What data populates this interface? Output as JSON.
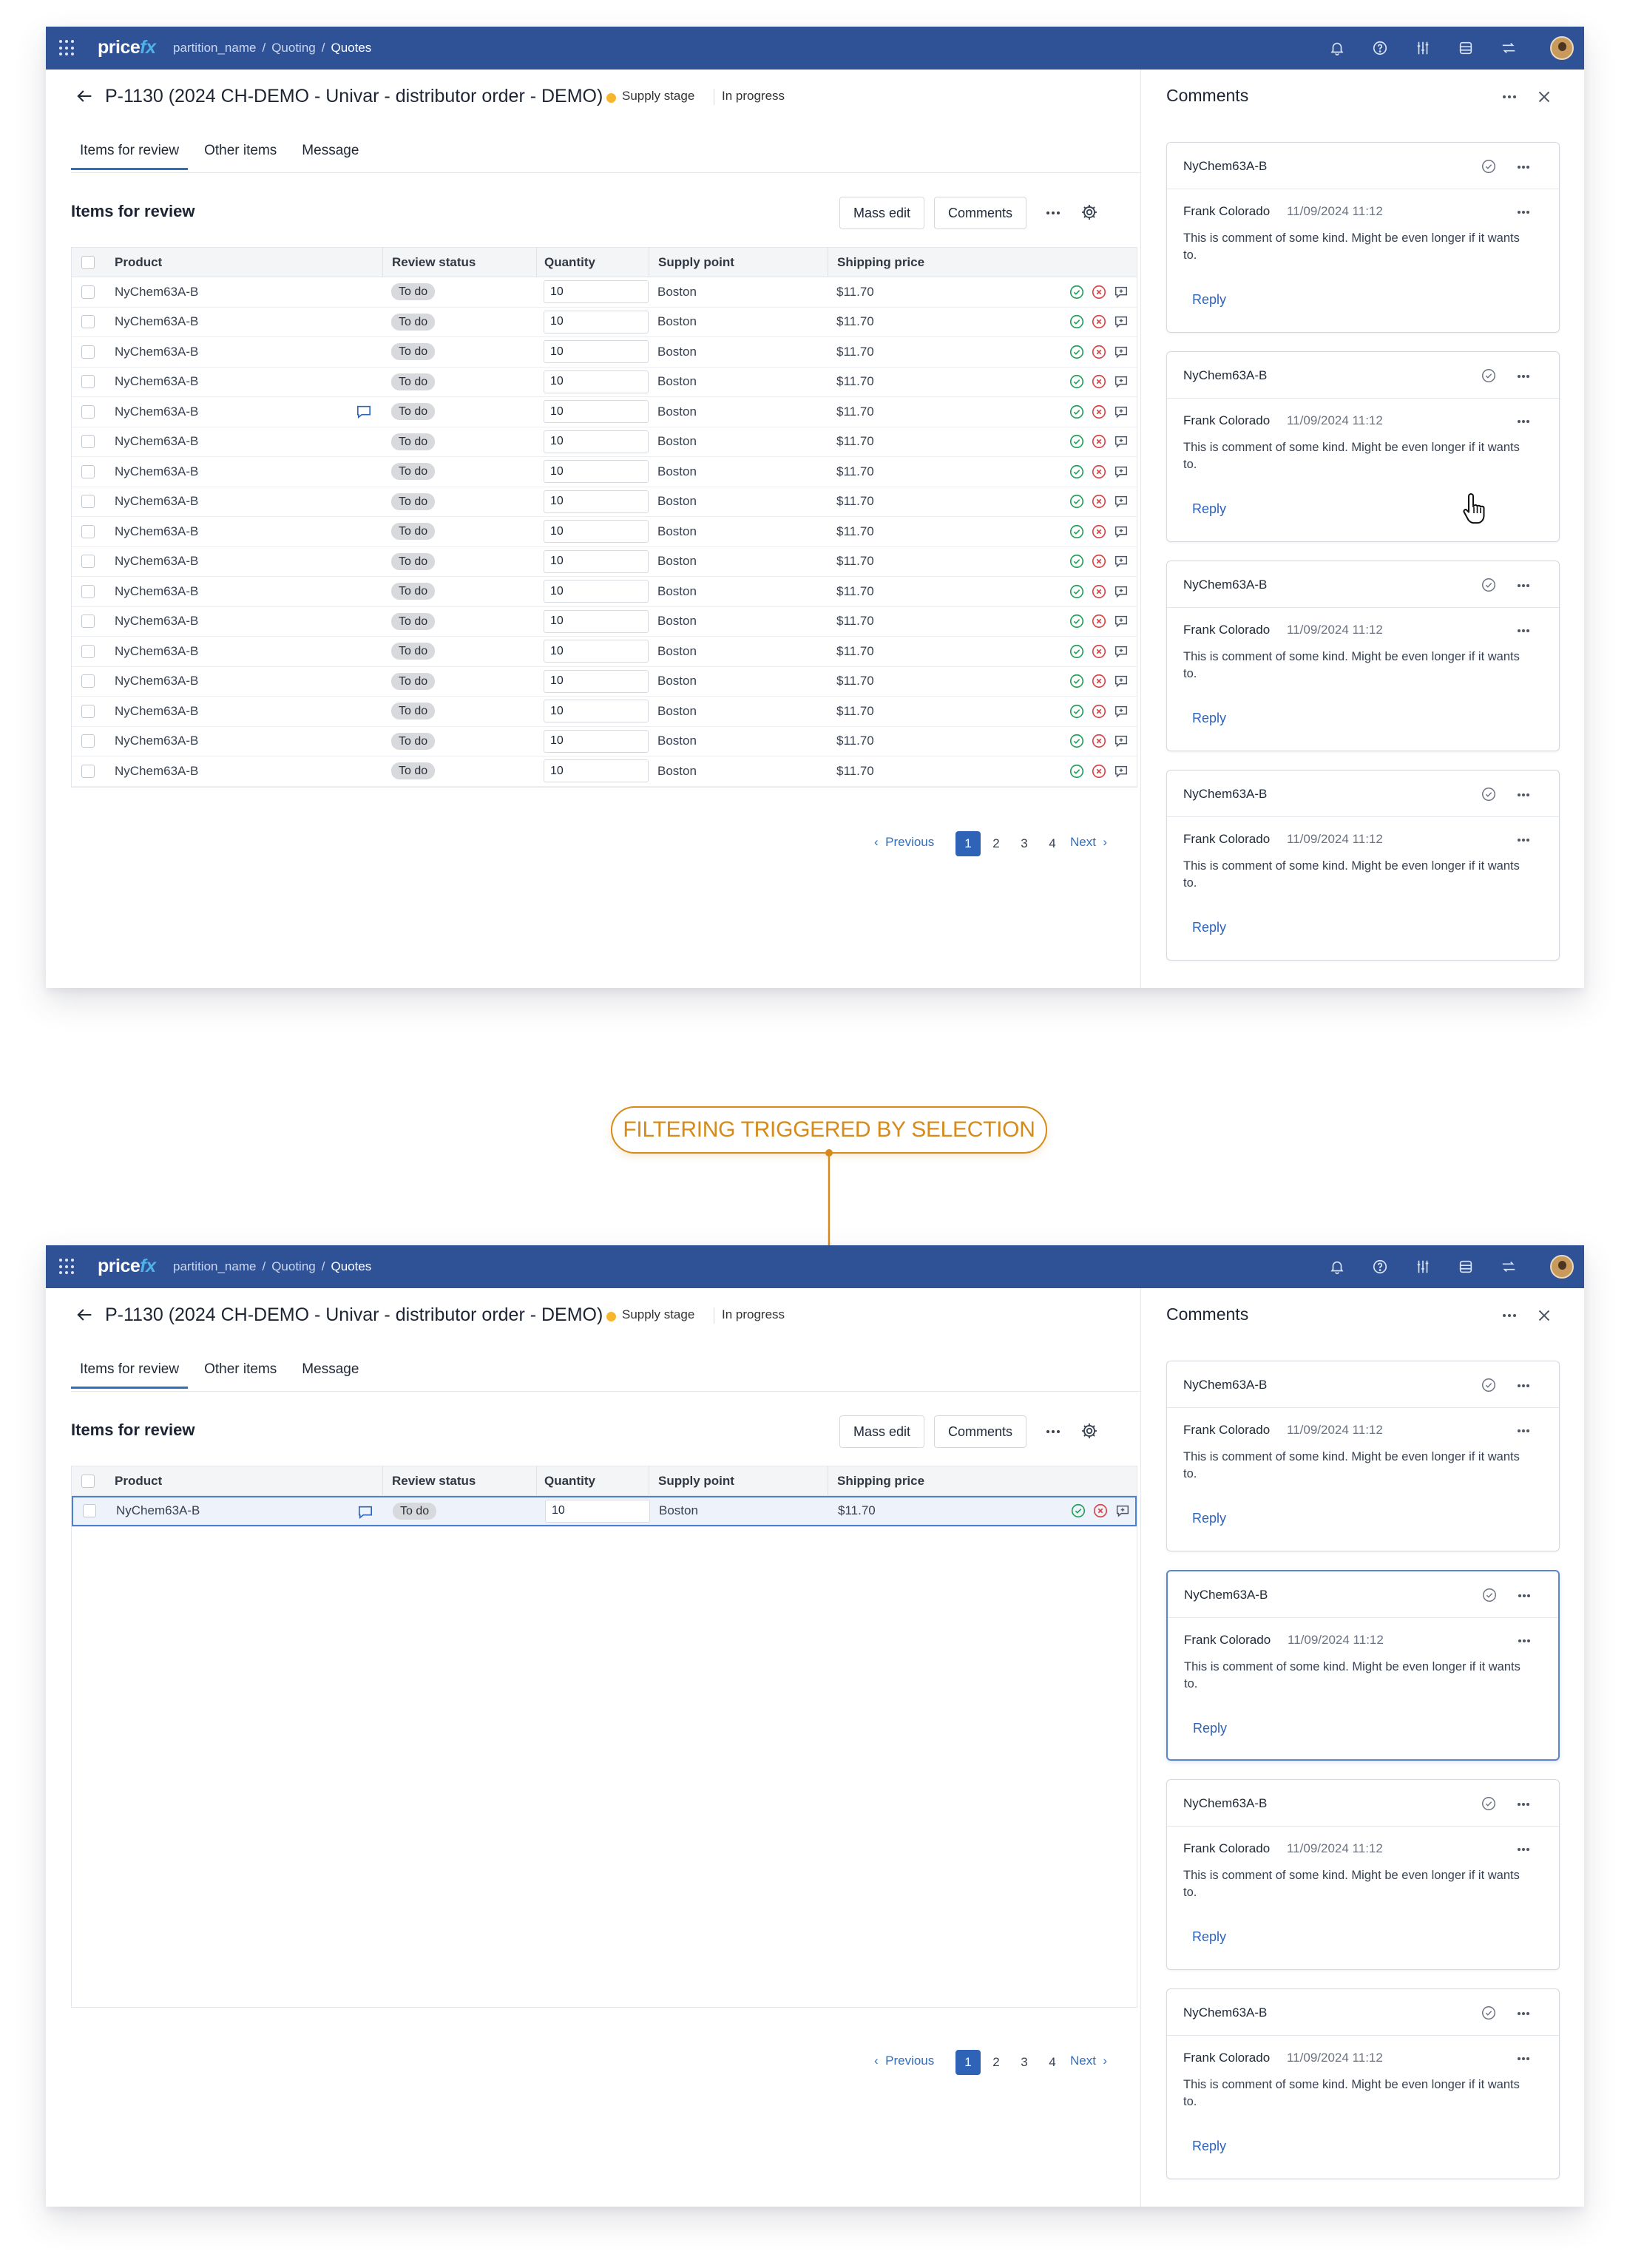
{
  "callout": {
    "label": "FILTERING TRIGGERED BY SELECTION"
  },
  "colors": {
    "topbar": "#2f5196",
    "accent": "#2f63b8",
    "callout": "#d68a1a",
    "stage_dot": "#f5b52c",
    "approve": "#23a05a",
    "reject": "#d64545"
  },
  "app": {
    "logo_price": "price",
    "logo_fx": "fx",
    "breadcrumb": [
      "partition_name",
      "Quoting",
      "Quotes"
    ],
    "breadcrumb_sep": "/",
    "top_icons": [
      "bell-icon",
      "help-icon",
      "sliders-icon",
      "database-icon",
      "transfer-icon"
    ]
  },
  "page": {
    "title": "P-1130 (2024 CH-DEMO - Univar - distributor order - DEMO)",
    "stage": "Supply stage",
    "status": "In progress",
    "tabs": [
      "Items for review",
      "Other items",
      "Message"
    ],
    "active_tab": "Items for review",
    "section_title": "Items for review",
    "mass_edit_label": "Mass edit",
    "comments_btn_label": "Comments"
  },
  "grid": {
    "columns": [
      "Product",
      "Review status",
      "Quantity",
      "Supply point",
      "Shipping price"
    ],
    "row": {
      "product": "NyChem63A-B",
      "status": "To do",
      "quantity": "10",
      "supply_point": "Boston",
      "shipping_price": "$11.70"
    },
    "frame1_row_count": 17,
    "frame1_comment_row_index": 4,
    "frame2_row_count": 1
  },
  "pagination": {
    "previous": "Previous",
    "next": "Next",
    "pages": [
      "1",
      "2",
      "3",
      "4"
    ],
    "current": "1"
  },
  "comments_panel": {
    "title": "Comments",
    "cards": [
      {
        "product": "NyChem63A-B",
        "author": "Frank Colorado",
        "date": "11/09/2024 11:12",
        "text": "This is comment of some kind. Might be even longer if it wants to.",
        "reply": "Reply"
      },
      {
        "product": "NyChem63A-B",
        "author": "Frank Colorado",
        "date": "11/09/2024 11:12",
        "text": "This is comment of some kind. Might be even longer if it wants to.",
        "reply": "Reply"
      },
      {
        "product": "NyChem63A-B",
        "author": "Frank Colorado",
        "date": "11/09/2024 11:12",
        "text": "This is comment of some kind. Might be even longer if it wants to.",
        "reply": "Reply"
      },
      {
        "product": "NyChem63A-B",
        "author": "Frank Colorado",
        "date": "11/09/2024 11:12",
        "text": "This is comment of some kind. Might be even longer if it wants to.",
        "reply": "Reply"
      }
    ],
    "frame2_highlighted_card": 1
  }
}
